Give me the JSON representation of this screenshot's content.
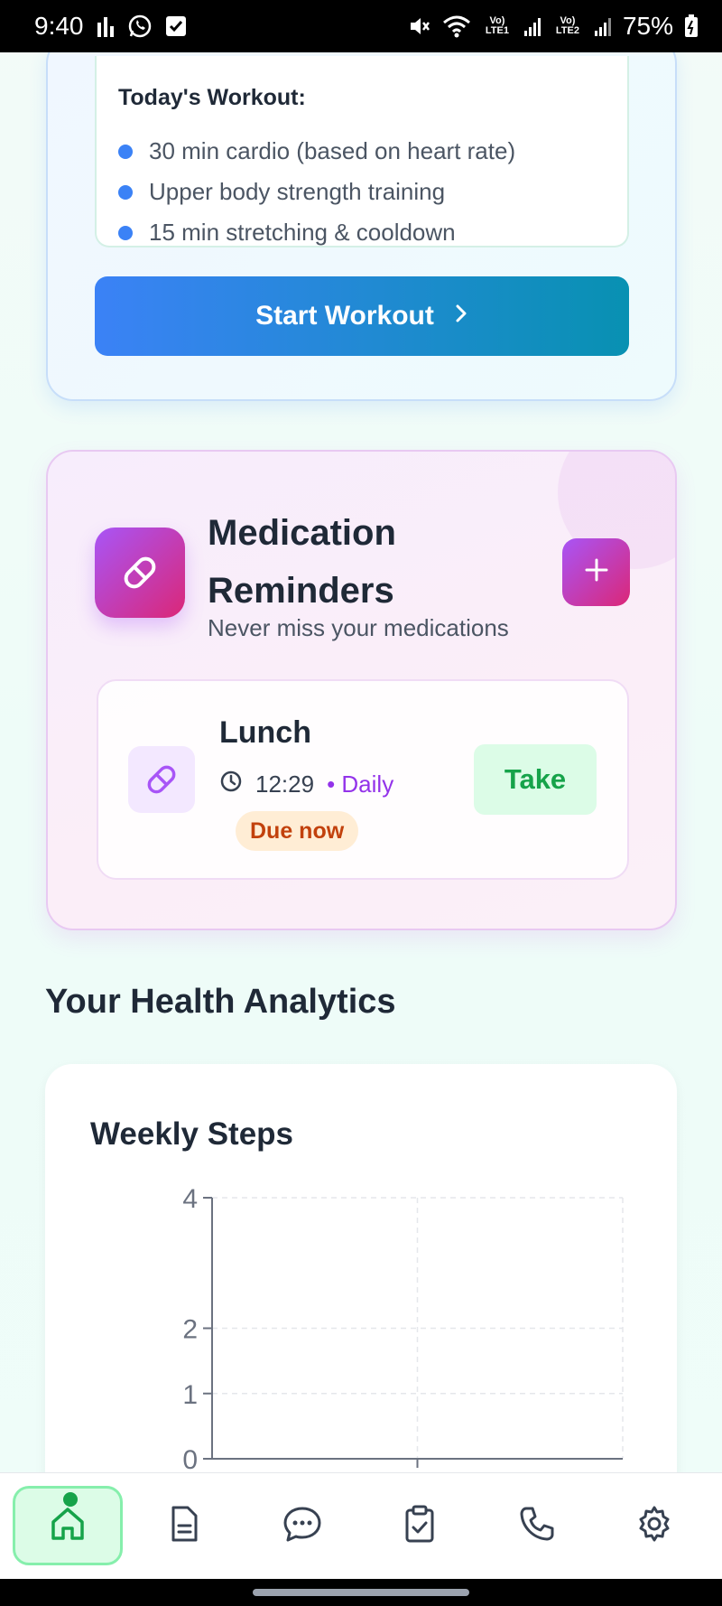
{
  "status_bar": {
    "time": "9:40",
    "battery": "75%",
    "sim1": "Vo) LTE1",
    "sim2": "Vo) LTE2"
  },
  "workout": {
    "title": "Today's Workout:",
    "items": [
      "30 min cardio (based on heart rate)",
      "Upper body strength training",
      "15 min stretching & cooldown"
    ],
    "start_label": "Start Workout"
  },
  "medication": {
    "title": "Medication Reminders",
    "subtitle": "Never miss your medications",
    "reminder": {
      "name": "Lunch",
      "time": "12:29",
      "frequency": "• Daily",
      "status": "Due now",
      "take_label": "Take"
    }
  },
  "analytics": {
    "title": "Your Health Analytics"
  },
  "chart_data": {
    "type": "bar",
    "title": "Weekly Steps",
    "categories": [],
    "values": [],
    "xlabel": "",
    "ylabel": "",
    "yticks": [
      0,
      1,
      2,
      4
    ],
    "ylim": [
      0,
      4
    ],
    "grid": true
  },
  "nav": {
    "items": [
      "home-icon",
      "document-icon",
      "chat-icon",
      "clipboard-check-icon",
      "phone-icon",
      "gear-icon"
    ],
    "active_index": 0
  },
  "colors": {
    "accent_blue": "#3b82f6",
    "accent_teal": "#0891b2",
    "accent_purple": "#a855f7",
    "accent_pink": "#db2777",
    "success_green": "#16a34a",
    "warning_orange": "#c2410c"
  }
}
